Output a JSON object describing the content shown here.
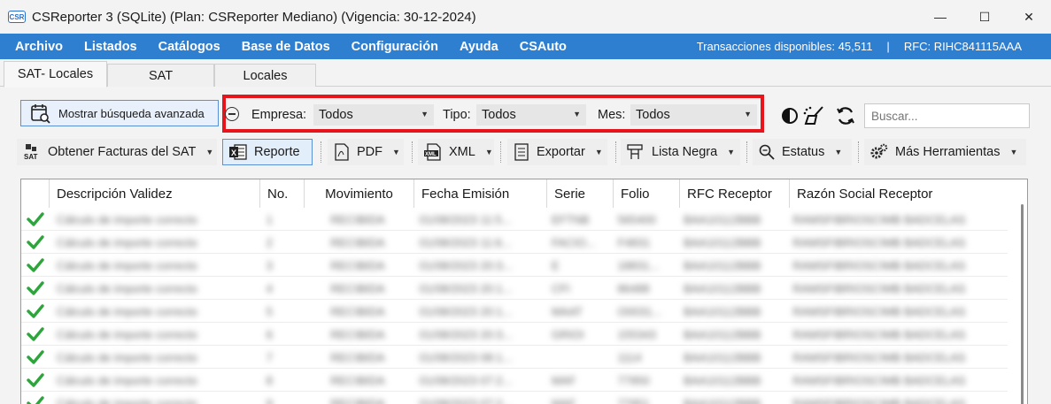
{
  "window": {
    "title": "CSReporter 3 (SQLite) (Plan: CSReporter Mediano) (Vigencia: 30-12-2024)",
    "app_icon_label": "CSR",
    "controls": {
      "minimize": "—",
      "maximize": "☐",
      "close": "✕"
    }
  },
  "menu": {
    "items": [
      "Archivo",
      "Listados",
      "Catálogos",
      "Base de Datos",
      "Configuración",
      "Ayuda",
      "CSAuto"
    ],
    "transactions_label": "Transacciones disponibles: 45,511",
    "separator": "|",
    "rfc_label": "RFC: RIHC841115AAA"
  },
  "tabs": [
    "SAT- Locales",
    "SAT",
    "Locales"
  ],
  "filters": {
    "advanced_search_label": "Mostrar búsqueda avanzada",
    "empresa_label": "Empresa:",
    "empresa_value": "Todos",
    "tipo_label": "Tipo:",
    "tipo_value": "Todos",
    "mes_label": "Mes:",
    "mes_value": "Todos",
    "search_placeholder": "Buscar...",
    "highlight_color": "#e8141c"
  },
  "toolbar": {
    "obtener": "Obtener Facturas del SAT",
    "reporte": "Reporte",
    "pdf": "PDF",
    "xml": "XML",
    "exportar": "Exportar",
    "lista_negra": "Lista Negra",
    "estatus": "Estatus",
    "mas": "Más Herramientas"
  },
  "grid": {
    "columns": [
      "Descripción Validez",
      "No.",
      "Movimiento",
      "Fecha Emisión",
      "Serie",
      "Folio",
      "RFC Receptor",
      "Razón Social Receptor"
    ],
    "rows": [
      {
        "desc": "Cálculo de importe correcto",
        "no": "1",
        "mov": "RECIBIDA",
        "fecha": "01/08/2023 11:5...",
        "serie": "EFTNB",
        "folio": "565400",
        "rfc": "BAA10112BBB",
        "razon": "RAMSFIBRIOSCIMB BADCELAS"
      },
      {
        "desc": "Cálculo de importe correcto",
        "no": "2",
        "mov": "RECIBIDA",
        "fecha": "01/08/2023 11:6...",
        "serie": "FACIO...",
        "folio": "F4831",
        "rfc": "BAA10112BBB",
        "razon": "RAMSFIBRIOSCIMB BADCELAS"
      },
      {
        "desc": "Cálculo de importe correcto",
        "no": "3",
        "mov": "RECIBIDA",
        "fecha": "01/08/2023 20:3...",
        "serie": "E",
        "folio": "18831...",
        "rfc": "BAA10112BBB",
        "razon": "RAMSFIBRIOSCIMB BADCELAS"
      },
      {
        "desc": "Cálculo de importe correcto",
        "no": "4",
        "mov": "RECIBIDA",
        "fecha": "01/08/2023 20:1...",
        "serie": "CFI",
        "folio": "86488",
        "rfc": "BAA10112BBB",
        "razon": "RAMSFIBRIOSCIMB BADCELAS"
      },
      {
        "desc": "Cálculo de importe correcto",
        "no": "5",
        "mov": "RECIBIDA",
        "fecha": "01/08/2023 20:1...",
        "serie": "MAAT",
        "folio": "O0031...",
        "rfc": "BAA10112BBB",
        "razon": "RAMSFIBRIOSCIMB BADCELAS"
      },
      {
        "desc": "Cálculo de importe correcto",
        "no": "6",
        "mov": "RECIBIDA",
        "fecha": "01/08/2023 20:3...",
        "serie": "GRIOI",
        "folio": "155343",
        "rfc": "BAA10112BBB",
        "razon": "RAMSFIBRIOSCIMB BADCELAS"
      },
      {
        "desc": "Cálculo de importe correcto",
        "no": "7",
        "mov": "RECIBIDA",
        "fecha": "01/08/2023 08:1...",
        "serie": "",
        "folio": "1114",
        "rfc": "BAA10112BBB",
        "razon": "RAMSFIBRIOSCIMB BADCELAS"
      },
      {
        "desc": "Cálculo de importe correcto",
        "no": "8",
        "mov": "RECIBIDA",
        "fecha": "01/08/2023 07:2...",
        "serie": "MAF",
        "folio": "77950",
        "rfc": "BAA10112BBB",
        "razon": "RAMSFIBRIOSCIMB BADCELAS"
      },
      {
        "desc": "Cálculo de importe correcto",
        "no": "9",
        "mov": "RECIBIDA",
        "fecha": "01/08/2023 07:2...",
        "serie": "MAF",
        "folio": "77951",
        "rfc": "BAA10112BBB",
        "razon": "RAMSFIBRIOSCIMB BADCELAS"
      }
    ],
    "check_color": "#2ea43c"
  }
}
